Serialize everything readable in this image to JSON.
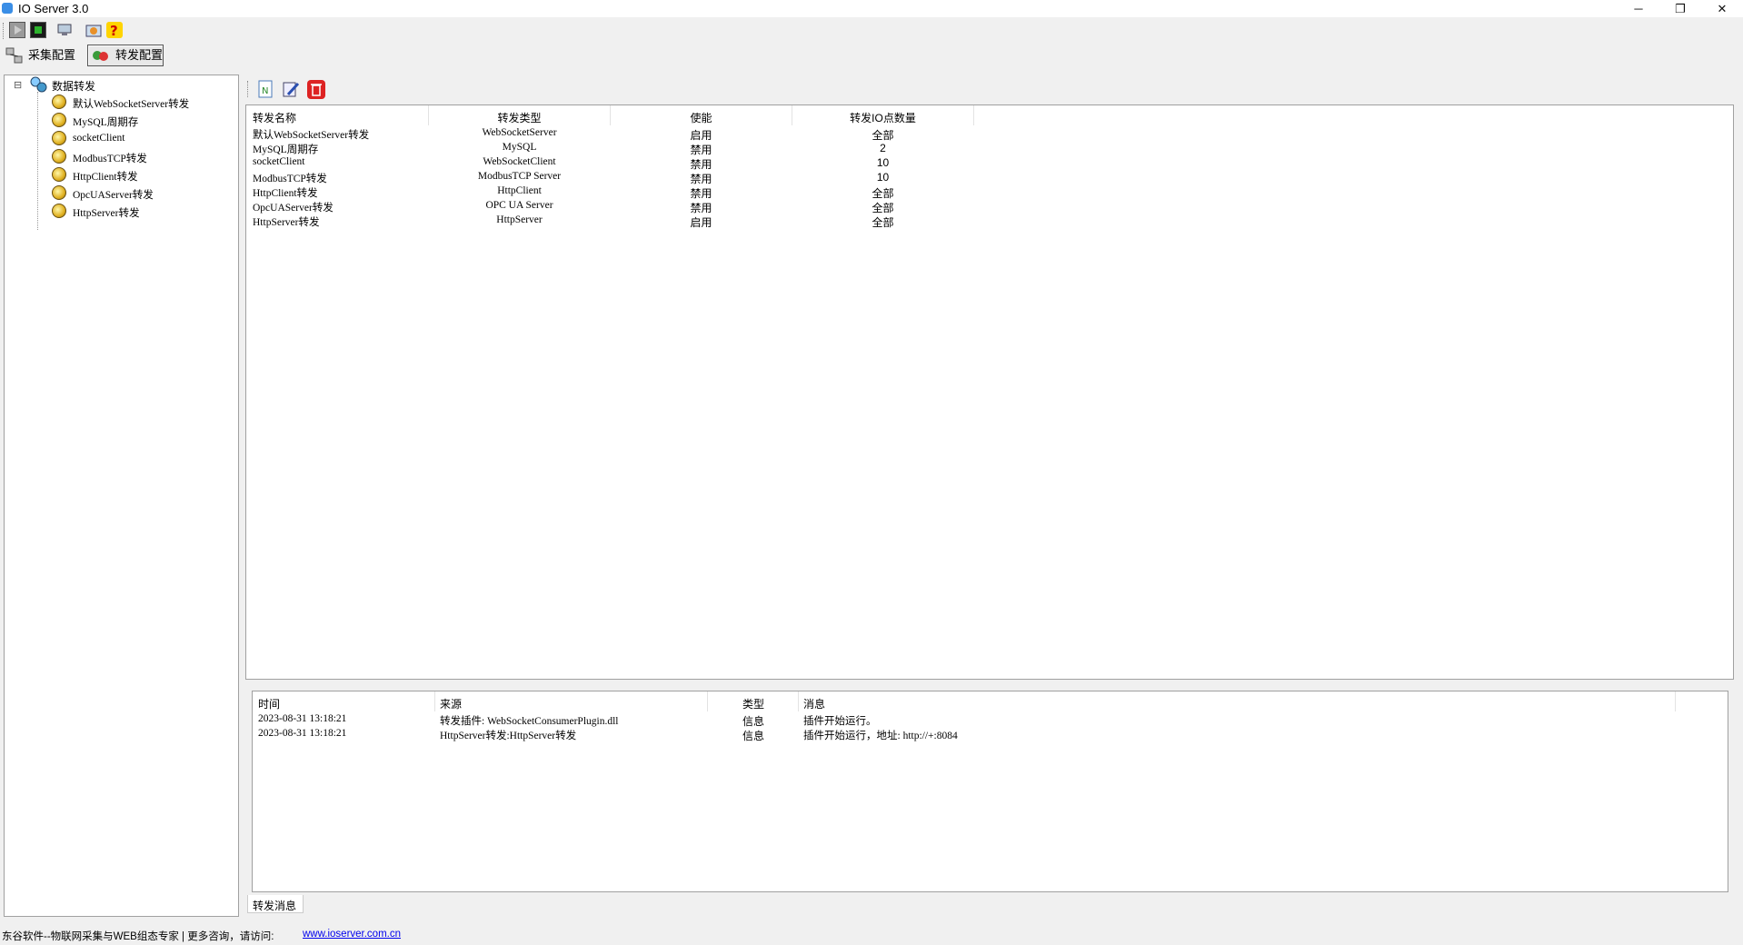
{
  "window": {
    "title": "IO Server 3.0",
    "minimize": "─",
    "restore": "❐",
    "close": "✕"
  },
  "tabs": [
    {
      "label": "采集配置"
    },
    {
      "label": "转发配置"
    }
  ],
  "tree": {
    "root": "数据转发",
    "collapse_glyph": "⊟",
    "items": [
      {
        "label": "默认WebSocketServer转发"
      },
      {
        "label": "MySQL周期存"
      },
      {
        "label": "socketClient"
      },
      {
        "label": "ModbusTCP转发"
      },
      {
        "label": "HttpClient转发"
      },
      {
        "label": "OpcUAServer转发"
      },
      {
        "label": "HttpServer转发"
      }
    ]
  },
  "forward_table": {
    "columns": [
      "转发名称",
      "转发类型",
      "使能",
      "转发IO点数量"
    ],
    "rows": [
      [
        "默认WebSocketServer转发",
        "WebSocketServer",
        "启用",
        "全部"
      ],
      [
        "MySQL周期存",
        "MySQL",
        "禁用",
        "2"
      ],
      [
        "socketClient",
        "WebSocketClient",
        "禁用",
        "10"
      ],
      [
        "ModbusTCP转发",
        "ModbusTCP Server",
        "禁用",
        "10"
      ],
      [
        "HttpClient转发",
        "HttpClient",
        "禁用",
        "全部"
      ],
      [
        "OpcUAServer转发",
        "OPC UA Server",
        "禁用",
        "全部"
      ],
      [
        "HttpServer转发",
        "HttpServer",
        "启用",
        "全部"
      ]
    ]
  },
  "log_table": {
    "columns": [
      "时间",
      "来源",
      "类型",
      "消息"
    ],
    "rows": [
      [
        "2023-08-31 13:18:21",
        "转发插件: WebSocketConsumerPlugin.dll",
        "信息",
        "插件开始运行。"
      ],
      [
        "2023-08-31 13:18:21",
        "HttpServer转发:HttpServer转发",
        "信息",
        "插件开始运行，地址: http://+:8084"
      ]
    ]
  },
  "log_tab": "转发消息",
  "status": {
    "text": "东谷软件--物联网采集与WEB组态专家 | 更多咨询，请访问:",
    "link": "www.ioserver.com.cn"
  },
  "colors": {
    "accent_red": "#d22",
    "link": "#0000ee"
  }
}
